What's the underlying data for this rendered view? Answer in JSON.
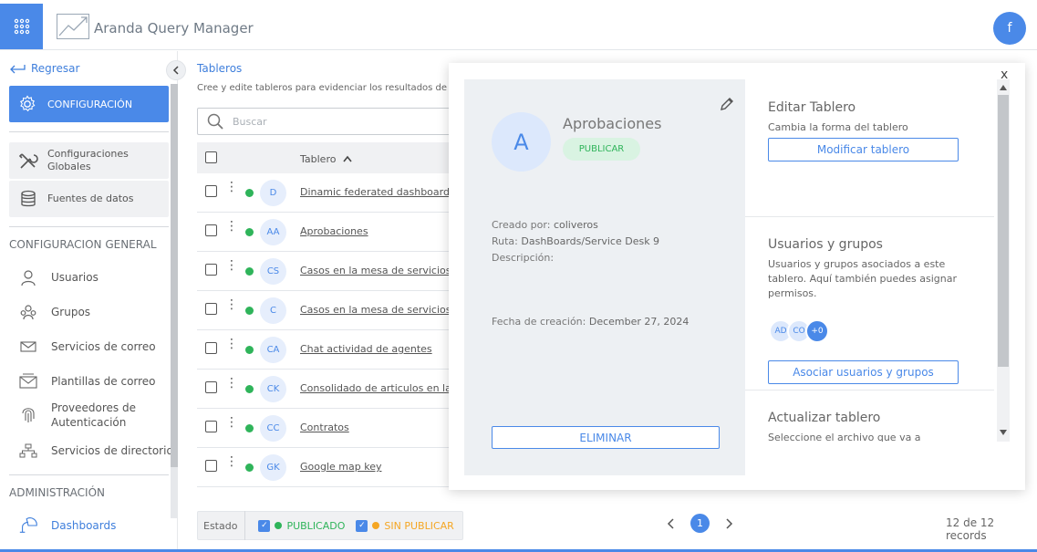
{
  "header": {
    "app_title": "Aranda Query Manager",
    "user_initial": "f",
    "apps_icon": "apps-grid-icon"
  },
  "sidebar": {
    "back_label": "Regresar",
    "active_label": "CONFIGURACIÓN",
    "sub_items": [
      {
        "label": "Configuraciones Globales",
        "icon": "tools-icon"
      },
      {
        "label": "Fuentes de datos",
        "icon": "database-icon"
      }
    ],
    "general_section": "CONFIGURACION GENERAL",
    "general_items": [
      {
        "label": "Usuarios",
        "icon": "user-icon"
      },
      {
        "label": "Grupos",
        "icon": "group-icon"
      },
      {
        "label": "Servicios de correo",
        "icon": "mail-icon"
      },
      {
        "label": "Plantillas de correo",
        "icon": "mail-template-icon"
      },
      {
        "label": "Proveedores de Autenticación",
        "icon": "fingerprint-icon"
      },
      {
        "label": "Servicios de directorio",
        "icon": "directory-icon"
      }
    ],
    "admin_section": "ADMINISTRACIÓN",
    "admin_items": [
      {
        "label": "Dashboards",
        "icon": "dashboard-icon"
      }
    ]
  },
  "main": {
    "title": "Tableros",
    "subtitle": "Cree y edite tableros para evidenciar los resultados de",
    "search_placeholder": "Buscar",
    "column_header": "Tablero",
    "rows": [
      {
        "initials": "D",
        "name": "Dinamic federated dashboard"
      },
      {
        "initials": "AA",
        "name": "Aprobaciones"
      },
      {
        "initials": "CS",
        "name": "Casos en la mesa de servicios"
      },
      {
        "initials": "C",
        "name": "Casos en la mesa de servicios S"
      },
      {
        "initials": "CA",
        "name": "Chat actividad de agentes"
      },
      {
        "initials": "CK",
        "name": "Consolidado de articulos en la K"
      },
      {
        "initials": "CC",
        "name": "Contratos"
      },
      {
        "initials": "GK",
        "name": "Google map key"
      }
    ],
    "state_label": "Estado",
    "published_label": "PUBLICADO",
    "unpublished_label": "SIN PUBLICAR",
    "current_page": "1",
    "records": "12 de 12 records"
  },
  "modal": {
    "close": "x",
    "card": {
      "avatar_letter": "A",
      "title": "Aprobaciones",
      "badge": "PUBLICAR",
      "created_by_key": "Creado por:",
      "created_by_val": "coliveros",
      "route_key": "Ruta:",
      "route_val": "DashBoards/Service Desk 9",
      "description_key": "Descripción:",
      "created_date_key": "Fecha de creación:",
      "created_date_val": "December 27, 2024",
      "delete_label": "ELIMINAR"
    },
    "edit": {
      "title": "Editar Tablero",
      "desc": "Cambia la forma del tablero",
      "button": "Modificar tablero"
    },
    "users": {
      "title": "Usuarios y grupos",
      "desc": "Usuarios y grupos asociados a este tablero. Aquí también puedes asignar permisos.",
      "chips": [
        "AD",
        "CO",
        "+0"
      ],
      "button": "Asociar usuarios y grupos"
    },
    "update": {
      "title": "Actualizar tablero",
      "desc": "Seleccione el archivo que va a"
    }
  },
  "colors": {
    "accent": "#4a89e8",
    "published": "#2fb45a",
    "unpublished": "#f5a623"
  }
}
